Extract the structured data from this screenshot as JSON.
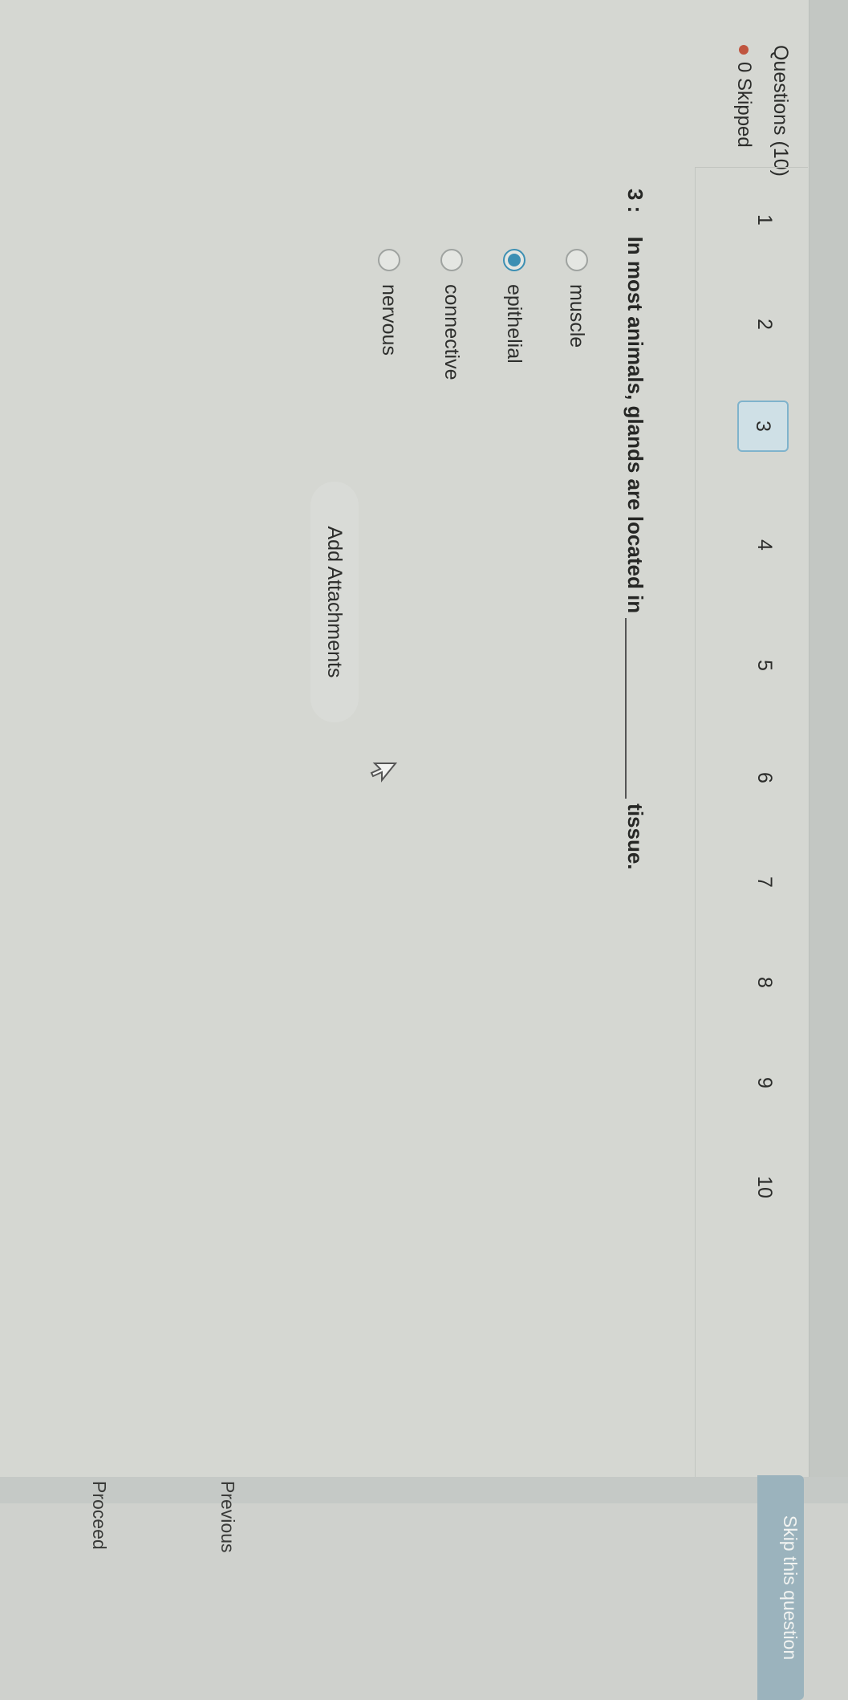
{
  "header": {
    "title": "Questions (10)",
    "skipped_label": "0 Skipped"
  },
  "question_nav": {
    "numbers": [
      "1",
      "2",
      "3",
      "4",
      "5",
      "6",
      "7",
      "8",
      "9",
      "10"
    ],
    "active": "3"
  },
  "question": {
    "number_label": "3 :",
    "text_before": "In most animals, glands are located in",
    "text_after": "tissue."
  },
  "options": [
    {
      "label": "muscle",
      "selected": false
    },
    {
      "label": "epithelial",
      "selected": true
    },
    {
      "label": "connective",
      "selected": false
    },
    {
      "label": "nervous",
      "selected": false
    }
  ],
  "attachments": {
    "label": "Add Attachments"
  },
  "footer": {
    "skip_label": "Skip this question",
    "previous_label": "Previous",
    "proceed_label": "Proceed"
  },
  "colors": {
    "accent": "#3c8fb3",
    "skipped_dot": "#c0553f",
    "active_question_bg": "#cfe0e6"
  }
}
